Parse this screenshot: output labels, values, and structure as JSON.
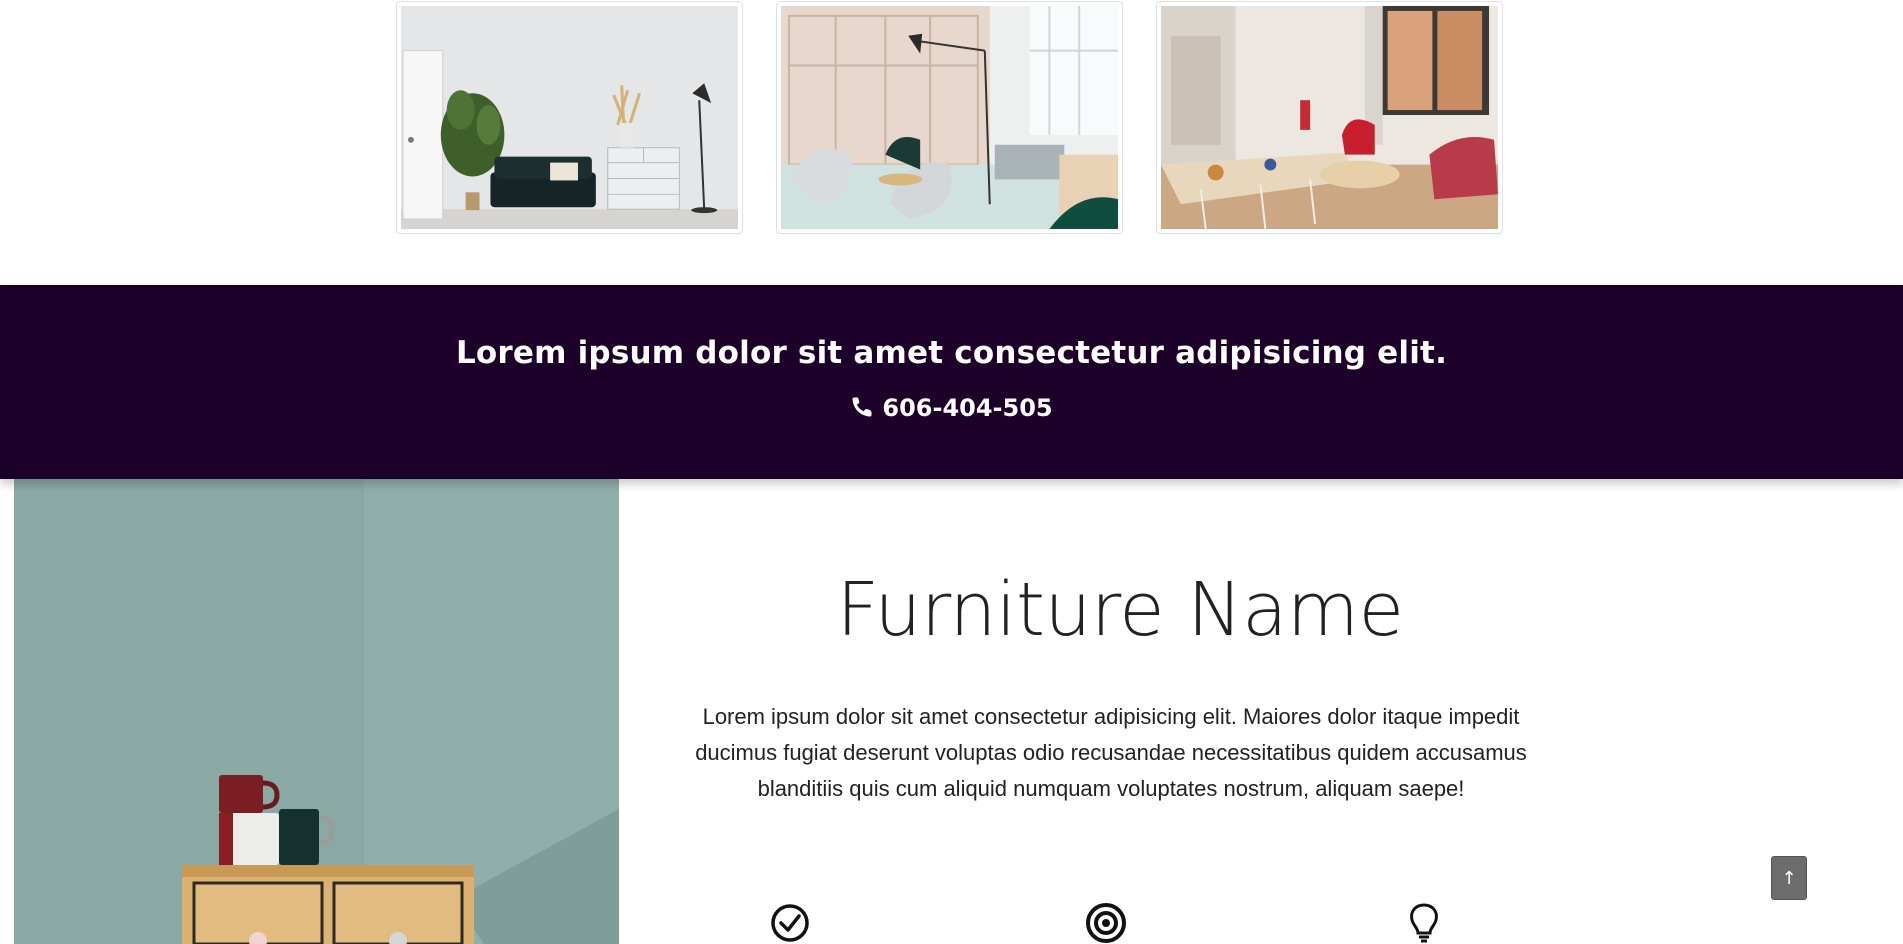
{
  "gallery": {
    "items": [
      {
        "alt": "living room with black sofa and white dresser"
      },
      {
        "alt": "bright lounge with grey chairs and floor lamp"
      },
      {
        "alt": "dining room with red armchair and window"
      }
    ]
  },
  "banner": {
    "title": "Lorem ipsum dolor sit amet consectetur adipisicing elit.",
    "phone": "606-404-505",
    "phone_icon": "phone-icon",
    "background": "#1c0029"
  },
  "product": {
    "title": "Furniture Name",
    "description": "Lorem ipsum dolor sit amet consectetur adipisicing elit. Maiores dolor itaque impedit ducimus fugiat deserunt voluptas odio recusandae necessitatibus quidem accusamus blanditiis quis cum aliquid numquam voluptates nostrum, aliquam saepe!",
    "features": [
      {
        "icon": "check-circle-icon"
      },
      {
        "icon": "target-icon"
      },
      {
        "icon": "lightbulb-icon"
      }
    ],
    "image_alt": "wooden drawer cabinet with stacked mugs against teal wall"
  },
  "controls": {
    "next_label": ">",
    "to_top_label": "↑"
  }
}
